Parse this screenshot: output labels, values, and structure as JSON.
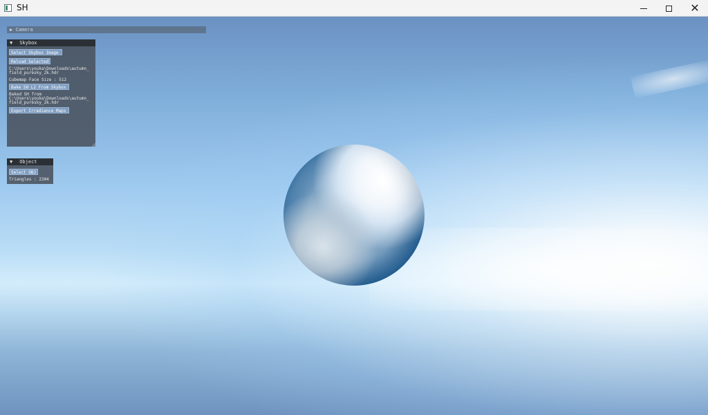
{
  "window": {
    "title": "SH",
    "controls": {
      "minimize": "minimize-icon",
      "maximize": "maximize-icon",
      "close": "close-icon"
    }
  },
  "camera_panel": {
    "label": "Camera"
  },
  "skybox_panel": {
    "label": "Skybox",
    "select_button": "Select Skybox Image",
    "reload_button": "Reload Selected",
    "path_line1": "C:\\Users\\youka\\Downloads\\autumn_",
    "path_line2": "field_puresky_2k.hdr",
    "cubemap_face_size": "Cubemap Face Size : 512",
    "bake_button": "Bake SH L2 From Skybox",
    "baked_label": "Baked SH from",
    "baked_path_line1": "C:\\Users\\youka\\Downloads\\autumn_",
    "baked_path_line2": "field_puresky_2k.hdr",
    "export_button": "Export Irradiance Maps"
  },
  "object_panel": {
    "label": "Object",
    "select_button": "Select OBJ",
    "triangles": "Triangles : 2304"
  }
}
